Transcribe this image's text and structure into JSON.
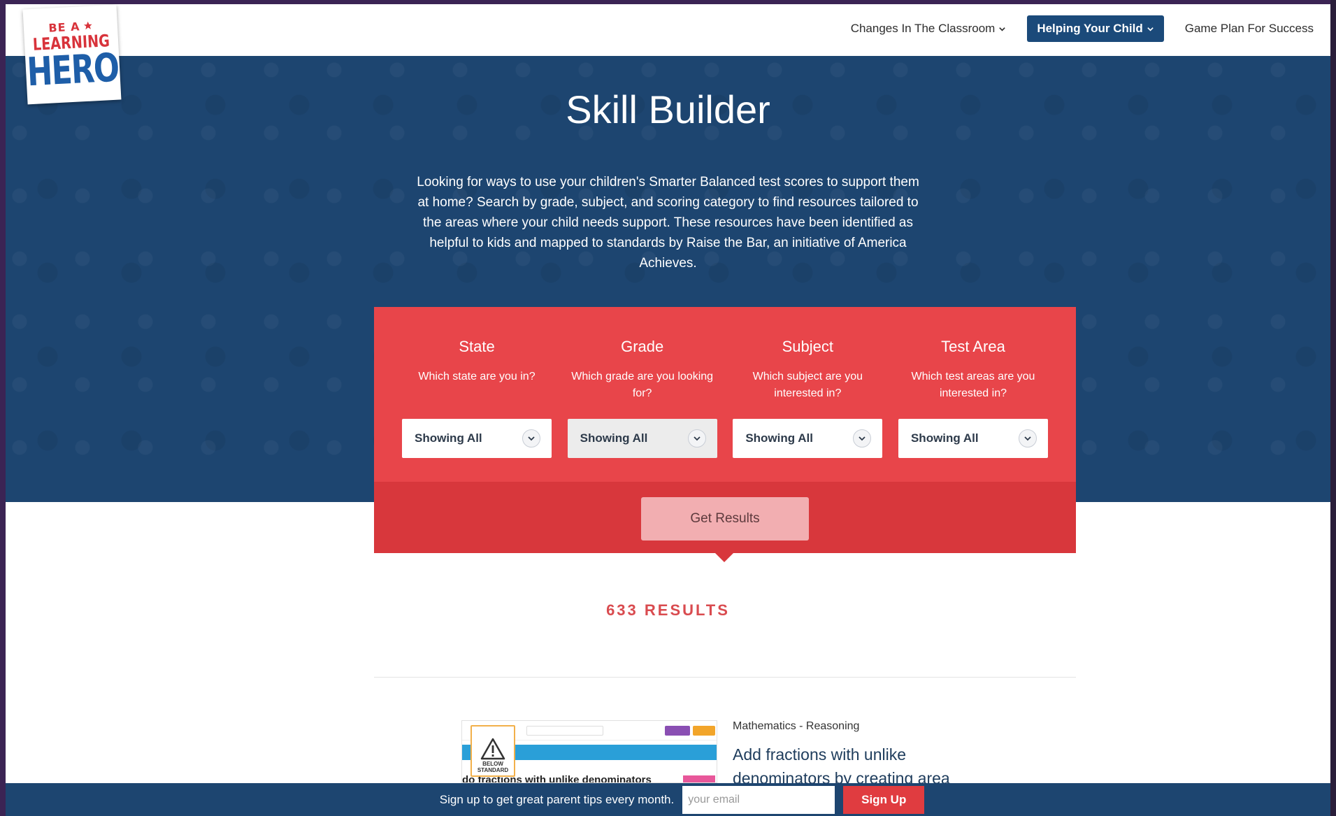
{
  "logo": {
    "line1": "BE A",
    "line2": "LEARNING",
    "line3": "HERO",
    "alt": "Be A Learning Hero"
  },
  "nav": {
    "items": [
      {
        "label": "Changes In The Classroom",
        "has_dropdown": true,
        "active": false
      },
      {
        "label": "Helping Your Child",
        "has_dropdown": true,
        "active": true
      },
      {
        "label": "Game Plan For Success",
        "has_dropdown": false,
        "active": false
      }
    ]
  },
  "hero": {
    "title": "Skill Builder",
    "description": "Looking for ways to use your children's Smarter Balanced test scores to support them at home? Search by grade, subject, and scoring category to find resources tailored to the areas where your child needs support. These resources have been identified as helpful to kids and mapped to standards by Raise the Bar, an initiative of America Achieves."
  },
  "filters": {
    "columns": [
      {
        "title": "State",
        "help": "Which state are you in?",
        "value": "Showing All"
      },
      {
        "title": "Grade",
        "help": "Which grade are you looking for?",
        "value": "Showing All"
      },
      {
        "title": "Subject",
        "help": "Which subject are you interested in?",
        "value": "Showing All"
      },
      {
        "title": "Test Area",
        "help": "Which test areas are you interested in?",
        "value": "Showing All"
      }
    ],
    "submit_label": "Get Results"
  },
  "results": {
    "count_text": "633 RESULTS",
    "items": [
      {
        "category": "Mathematics - Reasoning",
        "title": "Add fractions with unlike denominators by creating area",
        "thumb_caption": "do fractions with unlike denominators",
        "badge_text": "BELOW STANDARD"
      }
    ]
  },
  "signup": {
    "text": "Sign up to get great parent tips every month.",
    "placeholder": "your email",
    "button_label": "Sign Up"
  },
  "colors": {
    "navy": "#1d4570",
    "red": "#e8454a",
    "red_dark": "#d8373c",
    "results_red": "#d94b4f",
    "button_pink": "#f2aeb1"
  }
}
